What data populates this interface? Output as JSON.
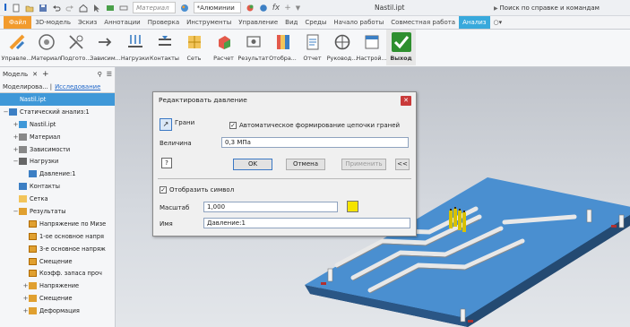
{
  "app": {
    "document_title": "Nastil.ipt",
    "help_search_placeholder": "Поиск по справке и командам",
    "material": "Материал",
    "appearance": "*Алюминии"
  },
  "tabs": [
    {
      "label": "Файл"
    },
    {
      "label": "3D-модель"
    },
    {
      "label": "Эскиз"
    },
    {
      "label": "Аннотации"
    },
    {
      "label": "Проверка"
    },
    {
      "label": "Инструменты"
    },
    {
      "label": "Управление"
    },
    {
      "label": "Вид"
    },
    {
      "label": "Среды"
    },
    {
      "label": "Начало работы"
    },
    {
      "label": "Совместная работа"
    },
    {
      "label": "Анализ"
    }
  ],
  "ribbon": [
    {
      "label": "Управле...",
      "icon": "manage-icon"
    },
    {
      "label": "Материал",
      "icon": "material-icon"
    },
    {
      "label": "Подгото...",
      "icon": "prepare-icon"
    },
    {
      "label": "Зависим...",
      "icon": "constraints-icon"
    },
    {
      "label": "Нагрузки",
      "icon": "loads-icon"
    },
    {
      "label": "Контакты",
      "icon": "contacts-icon"
    },
    {
      "label": "Сеть",
      "icon": "mesh-icon"
    },
    {
      "label": "Расчет",
      "icon": "solve-icon"
    },
    {
      "label": "Результат",
      "icon": "result-icon"
    },
    {
      "label": "Отобра...",
      "icon": "display-icon"
    },
    {
      "label": "Отчет",
      "icon": "report-icon"
    },
    {
      "label": "Руковод...",
      "icon": "guide-icon"
    },
    {
      "label": "Настрой...",
      "icon": "settings-icon"
    },
    {
      "label": "Выход",
      "icon": "exit-check-icon"
    }
  ],
  "browser": {
    "header": "Модель",
    "tab_modeling": "Моделирова...",
    "tab_research": "Исследование",
    "tree": [
      {
        "label": "Nastil.ipt",
        "level": 0,
        "icon": "part-icon",
        "toggle": "",
        "selected": true
      },
      {
        "label": "Статический анализ:1",
        "level": 0,
        "icon": "analysis-icon",
        "toggle": "−",
        "selected": false
      },
      {
        "label": "Nastil.ipt",
        "level": 1,
        "icon": "part-icon",
        "toggle": "+",
        "selected": false
      },
      {
        "label": "Материал",
        "level": 1,
        "icon": "material-folder-icon",
        "toggle": "+",
        "selected": false
      },
      {
        "label": "Зависимости",
        "level": 1,
        "icon": "constraints-folder-icon",
        "toggle": "+",
        "selected": false
      },
      {
        "label": "Нагрузки",
        "level": 1,
        "icon": "loads-folder-icon",
        "toggle": "−",
        "selected": false
      },
      {
        "label": "Давление:1",
        "level": 2,
        "icon": "pressure-icon",
        "toggle": "",
        "selected": false
      },
      {
        "label": "Контакты",
        "level": 1,
        "icon": "contacts-folder-icon",
        "toggle": "",
        "selected": false
      },
      {
        "label": "Сетка",
        "level": 1,
        "icon": "mesh-folder-icon",
        "toggle": "",
        "selected": false
      },
      {
        "label": "Результаты",
        "level": 1,
        "icon": "results-folder-icon",
        "toggle": "−",
        "selected": false
      },
      {
        "label": "Напряжение по Мизе",
        "level": 2,
        "icon": "result-plot-icon",
        "toggle": "",
        "selected": false
      },
      {
        "label": "1-ое основное напря",
        "level": 2,
        "icon": "result-plot-icon",
        "toggle": "",
        "selected": false
      },
      {
        "label": "3-е основное напряж",
        "level": 2,
        "icon": "result-plot-icon",
        "toggle": "",
        "selected": false
      },
      {
        "label": "Смещение",
        "level": 2,
        "icon": "result-plot-icon",
        "toggle": "",
        "selected": false
      },
      {
        "label": "Коэфф. запаса проч",
        "level": 2,
        "icon": "result-plot-icon",
        "toggle": "",
        "selected": false
      },
      {
        "label": "Напряжение",
        "level": 2,
        "icon": "result-folder-icon",
        "toggle": "+",
        "selected": false
      },
      {
        "label": "Смещение",
        "level": 2,
        "icon": "result-folder-icon",
        "toggle": "+",
        "selected": false
      },
      {
        "label": "Деформация",
        "level": 2,
        "icon": "result-folder-icon",
        "toggle": "+",
        "selected": false
      }
    ]
  },
  "dialog": {
    "title": "Редактировать давление",
    "faces_label": "Грани",
    "auto_chain_label": "Автоматическое формирование цепочки граней",
    "auto_chain_checked": true,
    "magnitude_label": "Величина",
    "magnitude_value": "0,3 МПа",
    "ok": "OK",
    "cancel": "Отмена",
    "apply": "Применить",
    "more": "<<",
    "show_symbol_label": "Отобразить символ",
    "show_symbol_checked": true,
    "scale_label": "Масштаб",
    "scale_value": "1,000",
    "name_label": "Имя",
    "name_value": "Давление:1",
    "symbol_color": "#f5e400"
  },
  "colors": {
    "accent": "#38a9dc",
    "file_tab": "#f29b2d",
    "selection": "#3f98d8",
    "plate_top": "#4a8fd0",
    "close_button": "#c93a3a"
  }
}
